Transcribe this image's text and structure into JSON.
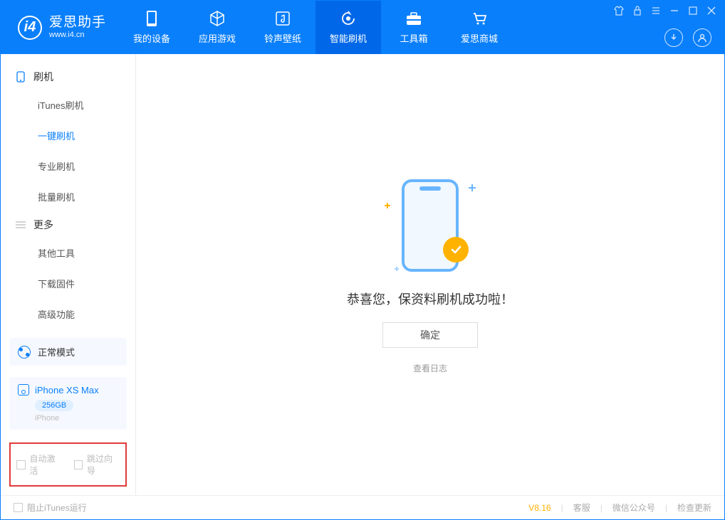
{
  "app": {
    "name_zh": "爱思助手",
    "name_en": "www.i4.cn"
  },
  "nav": {
    "tabs": [
      {
        "label": "我的设备",
        "icon": "device"
      },
      {
        "label": "应用游戏",
        "icon": "cube"
      },
      {
        "label": "铃声壁纸",
        "icon": "music"
      },
      {
        "label": "智能刷机",
        "icon": "refresh"
      },
      {
        "label": "工具箱",
        "icon": "toolbox"
      },
      {
        "label": "爱思商城",
        "icon": "cart"
      }
    ],
    "active_index": 3
  },
  "sidebar": {
    "categories": [
      {
        "title": "刷机",
        "icon": "phone-icon",
        "items": [
          "iTunes刷机",
          "一键刷机",
          "专业刷机",
          "批量刷机"
        ],
        "active_index": 1
      },
      {
        "title": "更多",
        "icon": "menu-icon",
        "items": [
          "其他工具",
          "下载固件",
          "高级功能"
        ],
        "active_index": -1
      }
    ],
    "mode_label": "正常模式",
    "device": {
      "name": "iPhone XS Max",
      "storage": "256GB",
      "type": "iPhone"
    },
    "options": {
      "auto_activate": "自动激活",
      "skip_guide": "跳过向导"
    }
  },
  "main": {
    "success_message": "恭喜您，保资料刷机成功啦！",
    "confirm_button": "确定",
    "view_log": "查看日志"
  },
  "footer": {
    "block_itunes": "阻止iTunes运行",
    "version": "V8.16",
    "links": [
      "客服",
      "微信公众号",
      "检查更新"
    ]
  }
}
